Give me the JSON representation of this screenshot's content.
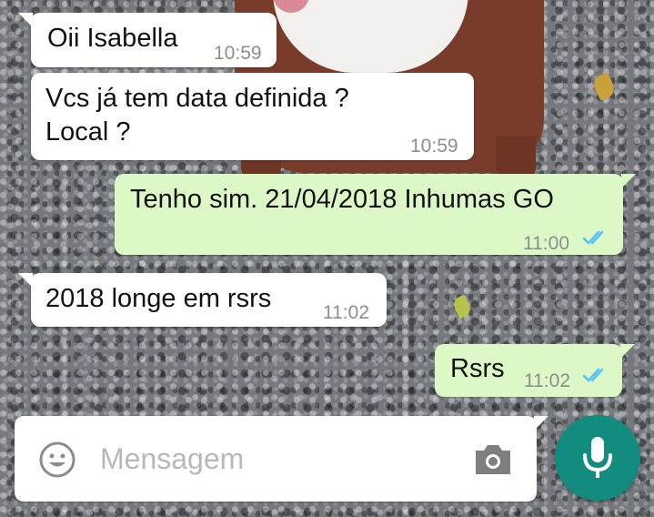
{
  "chat": {
    "messages": [
      {
        "direction": "incoming",
        "text": "Oii Isabella",
        "time": "10:59"
      },
      {
        "direction": "incoming",
        "lines": [
          "Vcs já tem data definida ?",
          "Local ?"
        ],
        "time": "10:59"
      },
      {
        "direction": "outgoing",
        "text": "Tenho sim. 21/04/2018 Inhumas GO",
        "time": "11:00",
        "status": "read"
      },
      {
        "direction": "incoming",
        "text": "2018 longe em rsrs",
        "time": "11:02"
      },
      {
        "direction": "outgoing",
        "text": "Rsrs",
        "time": "11:02",
        "status": "read"
      }
    ]
  },
  "composer": {
    "placeholder": "Mensagem",
    "value": "",
    "emoji_icon": "emoji-icon",
    "camera_icon": "camera-icon",
    "mic_icon": "mic-icon"
  },
  "colors": {
    "incoming_bubble": "#ffffff",
    "outgoing_bubble": "#dcf8c6",
    "read_ticks": "#4fc3f7",
    "mic_button": "#128c7e"
  }
}
